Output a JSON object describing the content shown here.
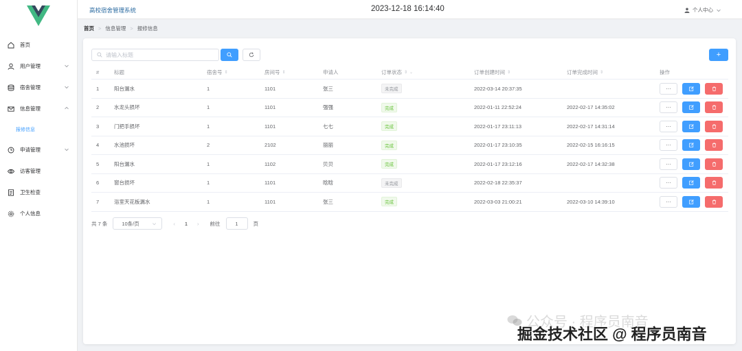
{
  "header": {
    "app_title": "高校宿舍管理系统",
    "datetime": "2023-12-18 16:14:40",
    "user_label": "个人中心"
  },
  "sidebar": {
    "items": [
      {
        "label": "首页",
        "icon": "home-icon"
      },
      {
        "label": "用户管理",
        "icon": "user-icon"
      },
      {
        "label": "宿舍管理",
        "icon": "database-icon"
      },
      {
        "label": "信息管理",
        "icon": "mail-icon"
      },
      {
        "label": "报修信息",
        "icon": ""
      },
      {
        "label": "申请管理",
        "icon": "clock-icon"
      },
      {
        "label": "访客管理",
        "icon": "eye-icon"
      },
      {
        "label": "卫生检查",
        "icon": "document-icon"
      },
      {
        "label": "个人信息",
        "icon": "gear-icon"
      }
    ]
  },
  "breadcrumb": [
    "首页",
    "信息管理",
    "报修信息"
  ],
  "search": {
    "placeholder": "请输入标题"
  },
  "buttons": {
    "add": "+"
  },
  "table": {
    "columns": [
      "#",
      "标题",
      "宿舍号",
      "房间号",
      "申请人",
      "订单状态",
      "订单创建时间",
      "订单完成时间",
      "操作"
    ],
    "rows": [
      {
        "idx": "1",
        "title": "阳台漏水",
        "dorm": "1",
        "room": "1101",
        "applicant": "张三",
        "status": "未完成",
        "created": "2022-03-14 20:37:35",
        "finished": ""
      },
      {
        "idx": "2",
        "title": "水龙头损坏",
        "dorm": "1",
        "room": "1101",
        "applicant": "强强",
        "status": "完成",
        "created": "2022-01-11 22:52:24",
        "finished": "2022-02-17 14:35:02"
      },
      {
        "idx": "3",
        "title": "门把手损坏",
        "dorm": "1",
        "room": "1101",
        "applicant": "七七",
        "status": "完成",
        "created": "2022-01-17 23:11:13",
        "finished": "2022-02-17 14:31:14"
      },
      {
        "idx": "4",
        "title": "水池损坏",
        "dorm": "2",
        "room": "2102",
        "applicant": "丽丽",
        "status": "完成",
        "created": "2022-01-17 23:10:35",
        "finished": "2022-02-15 16:16:15"
      },
      {
        "idx": "5",
        "title": "阳台漏水",
        "dorm": "1",
        "room": "1102",
        "applicant": "贝贝",
        "status": "完成",
        "created": "2022-01-17 23:12:16",
        "finished": "2022-02-17 14:32:38"
      },
      {
        "idx": "6",
        "title": "窗台损坏",
        "dorm": "1",
        "room": "1101",
        "applicant": "晗晗",
        "status": "未完成",
        "created": "2022-02-18 22:35:37",
        "finished": ""
      },
      {
        "idx": "7",
        "title": "浴室天花板漏水",
        "dorm": "1",
        "room": "1101",
        "applicant": "张三",
        "status": "完成",
        "created": "2022-03-03 21:00:21",
        "finished": "2022-03-10 14:39:10"
      }
    ],
    "more_label": "···"
  },
  "pagination": {
    "total": "共 7 条",
    "page_size": "10条/页",
    "current": "1",
    "goto_label": "前往",
    "goto_value": "1",
    "page_suffix": "页"
  },
  "watermark": {
    "line1": "公众号 · 程序员南音",
    "line2": "掘金技术社区 @ 程序员南音"
  },
  "colors": {
    "primary": "#409eff",
    "danger": "#f56c6c",
    "success": "#67c23a",
    "logo_green": "#41b883",
    "logo_dark": "#35495e"
  }
}
